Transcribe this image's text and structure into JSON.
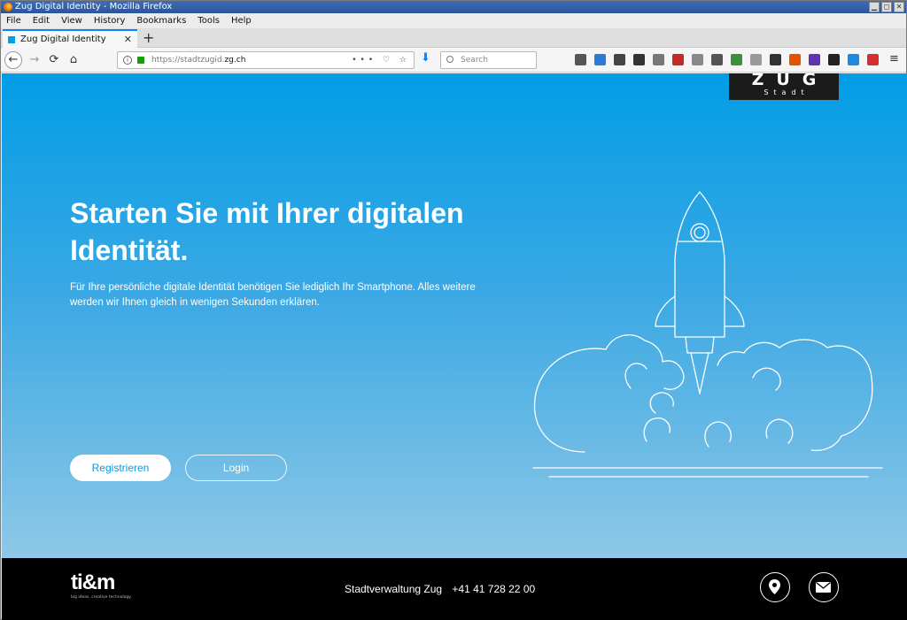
{
  "window": {
    "title": "Zug Digital Identity - Mozilla Firefox",
    "controls": [
      "▁",
      "◻",
      "✕"
    ]
  },
  "menu": {
    "items": [
      "File",
      "Edit",
      "View",
      "History",
      "Bookmarks",
      "Tools",
      "Help"
    ]
  },
  "tabs": [
    {
      "label": "Zug Digital Identity",
      "close": "✕"
    }
  ],
  "newtab_label": "+",
  "nav": {
    "back": "←",
    "forward": "→",
    "reload": "⟳",
    "home": "⌂",
    "url_prefix": "https://stadtzugid.",
    "url_domain": "zg.ch",
    "url_actions": "••• ♡ ☆",
    "download": "⬇",
    "search_placeholder": "Search",
    "menu": "≡"
  },
  "extensions": {
    "colors": [
      "#555555",
      "#2b7bd6",
      "#444444",
      "#333333",
      "#777777",
      "#c62828",
      "#888888",
      "#555555",
      "#3c8f3c",
      "#999999",
      "#333333",
      "#e65100",
      "#5e35b1",
      "#222222",
      "#1e88e5",
      "#d32f2f"
    ]
  },
  "page": {
    "logo": {
      "big": "ZUG",
      "small": "Stadt"
    },
    "headline": "Starten Sie mit Ihrer digitalen Identität.",
    "lead": "Für Ihre persönliche digitale Identität benötigen Sie lediglich Ihr Smartphone. Alles weitere werden wir Ihnen gleich in wenigen Sekunden erklären.",
    "register_label": "Registrieren",
    "login_label": "Login",
    "accent": "#029de6"
  },
  "footer": {
    "brand": "ti&m",
    "tagline": "big ideas. creative technology.",
    "org": "Stadtverwaltung Zug",
    "phone": "+41 41 728 22 00"
  }
}
